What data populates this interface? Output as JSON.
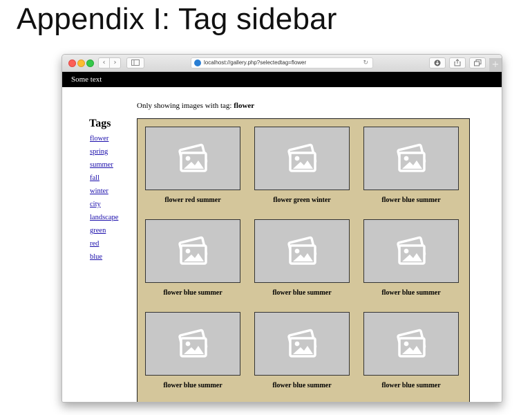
{
  "slide": {
    "title": "Appendix I: Tag sidebar"
  },
  "browser": {
    "url": "localhost://gallery.php?selectedtag=flower",
    "icons": {
      "back": "‹",
      "forward": "›",
      "reload": "↻",
      "new_tab": "+"
    }
  },
  "page": {
    "header_text": "Some text",
    "filter_prefix": "Only showing images with tag: ",
    "selected_tag": "flower",
    "tags_heading": "Tags",
    "tags": [
      "flower",
      "spring",
      "summer",
      "fall",
      "winter",
      "city",
      "landscape",
      "green",
      "red",
      "blue"
    ],
    "images": [
      {
        "caption": "flower red summer"
      },
      {
        "caption": "flower green winter"
      },
      {
        "caption": "flower blue summer"
      },
      {
        "caption": "flower blue summer"
      },
      {
        "caption": "flower blue summer"
      },
      {
        "caption": "flower blue summer"
      },
      {
        "caption": "flower blue summer"
      },
      {
        "caption": "flower blue summer"
      },
      {
        "caption": "flower blue summer"
      }
    ]
  },
  "colors": {
    "gallery_background": "#d4c69b",
    "thumbnail_placeholder": "#c7c7c7",
    "header_bar": "#000000",
    "link": "#1a0dab"
  }
}
